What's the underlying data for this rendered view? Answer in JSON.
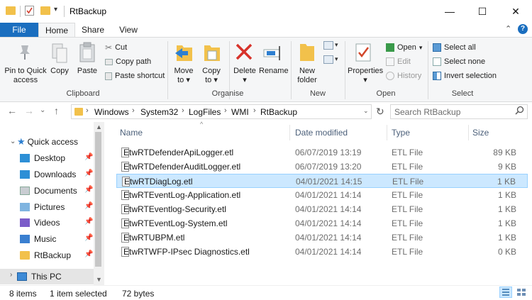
{
  "window": {
    "title": "RtBackup",
    "minimize": "—",
    "maximize": "☐",
    "close": "✕"
  },
  "ribbon_tabs": [
    "File",
    "Home",
    "Share",
    "View"
  ],
  "ribbon": {
    "clipboard": {
      "pin_line1": "Pin to Quick",
      "pin_line2": "access",
      "copy": "Copy",
      "paste": "Paste",
      "cut": "Cut",
      "copy_path": "Copy path",
      "paste_shortcut": "Paste shortcut",
      "group": "Clipboard"
    },
    "organise": {
      "move_to_line1": "Move",
      "move_to_line2": "to",
      "copy_to_line1": "Copy",
      "copy_to_line2": "to",
      "delete": "Delete",
      "rename": "Rename",
      "group": "Organise"
    },
    "new": {
      "new_folder_line1": "New",
      "new_folder_line2": "folder",
      "group": "New"
    },
    "open": {
      "properties": "Properties",
      "open": "Open",
      "edit": "Edit",
      "history": "History",
      "group": "Open"
    },
    "select": {
      "select_all": "Select all",
      "select_none": "Select none",
      "invert_selection": "Invert selection",
      "group": "Select"
    }
  },
  "address": {
    "crumbs": [
      "Windows",
      "System32",
      "LogFiles",
      "WMI",
      "RtBackup"
    ],
    "search_placeholder": "Search RtBackup"
  },
  "nav_pane": {
    "quick_access": "Quick access",
    "items": [
      "Desktop",
      "Downloads",
      "Documents",
      "Pictures",
      "Videos",
      "Music",
      "RtBackup"
    ],
    "this_pc": "This PC"
  },
  "columns": {
    "name": "Name",
    "date_modified": "Date modified",
    "type": "Type",
    "size": "Size"
  },
  "files": [
    {
      "name": "EtwRTDefenderApiLogger.etl",
      "date": "06/07/2019 13:19",
      "type": "ETL File",
      "size": "89 KB"
    },
    {
      "name": "EtwRTDefenderAuditLogger.etl",
      "date": "06/07/2019 13:20",
      "type": "ETL File",
      "size": "9 KB"
    },
    {
      "name": "EtwRTDiagLog.etl",
      "date": "04/01/2021 14:15",
      "type": "ETL File",
      "size": "1 KB"
    },
    {
      "name": "EtwRTEventLog-Application.etl",
      "date": "04/01/2021 14:14",
      "type": "ETL File",
      "size": "1 KB"
    },
    {
      "name": "EtwRTEventlog-Security.etl",
      "date": "04/01/2021 14:14",
      "type": "ETL File",
      "size": "1 KB"
    },
    {
      "name": "EtwRTEventLog-System.etl",
      "date": "04/01/2021 14:14",
      "type": "ETL File",
      "size": "1 KB"
    },
    {
      "name": "EtwRTUBPM.etl",
      "date": "04/01/2021 14:14",
      "type": "ETL File",
      "size": "1 KB"
    },
    {
      "name": "EtwRTWFP-IPsec Diagnostics.etl",
      "date": "04/01/2021 14:14",
      "type": "ETL File",
      "size": "0 KB"
    }
  ],
  "selected_index": 2,
  "status": {
    "items": "8 items",
    "selected": "1 item selected",
    "size": "72 bytes"
  }
}
